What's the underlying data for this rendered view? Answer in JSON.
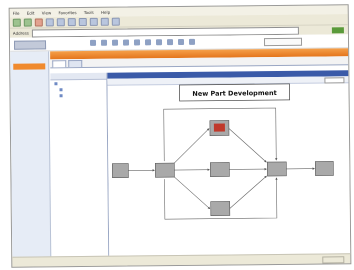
{
  "browser": {
    "menu": [
      "File",
      "Edit",
      "View",
      "Favorites",
      "Tools",
      "Help"
    ],
    "address_label": "Address",
    "address_value": "",
    "status_text": ""
  },
  "app": {
    "logo_text": "",
    "header_link": "",
    "left_nav": [
      "",
      "",
      "",
      "",
      ""
    ],
    "orange_bar_title": "",
    "tabs": [
      "",
      ""
    ],
    "strip_title": "",
    "tree_header": "",
    "tree_items": [
      "",
      "",
      ""
    ],
    "canvas_toolbar_text": "",
    "zoom_value": ""
  },
  "diagram": {
    "title": "New Part Development",
    "nodes": [
      "",
      "",
      "",
      "",
      "",
      "",
      ""
    ],
    "edge_labels": [
      "",
      "",
      "",
      "",
      "",
      "",
      "",
      ""
    ]
  },
  "colors": {
    "accent_orange": "#e4751c",
    "accent_blue": "#3a5aa8",
    "node_fill": "#a9a9a9",
    "active_node_fill": "#c0392b"
  }
}
